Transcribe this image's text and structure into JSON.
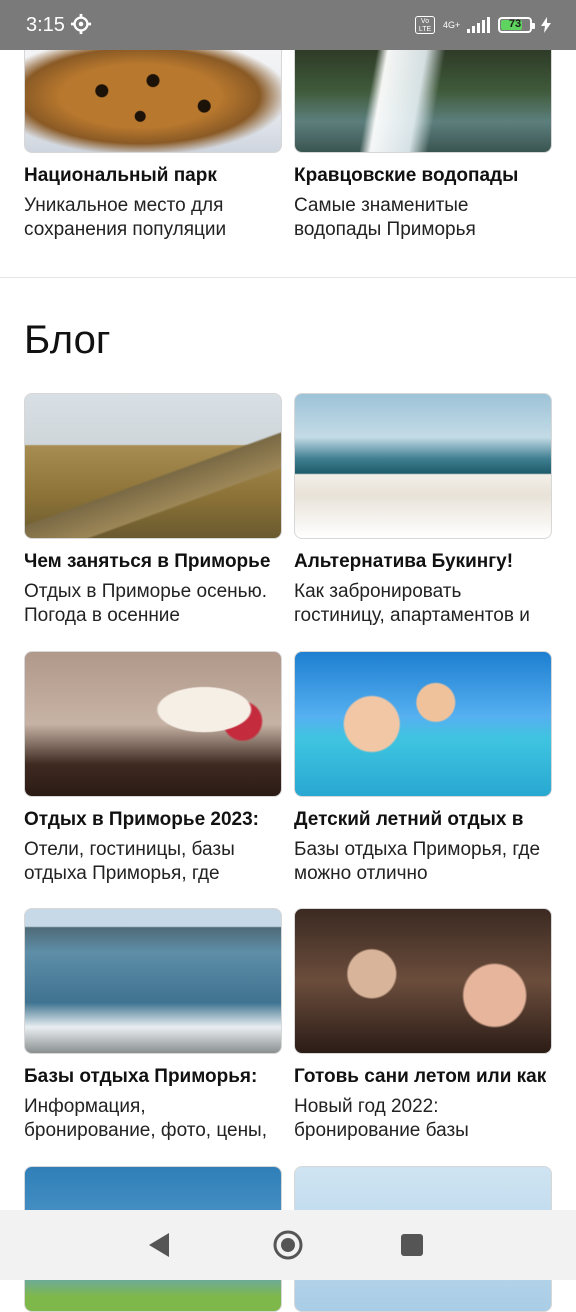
{
  "status_bar": {
    "time": "3:15",
    "network": "4G+",
    "volte": "Vo LTE",
    "battery": "73"
  },
  "top_cards": [
    {
      "title": "Национальный парк",
      "desc": "Уникальное место для сохранения популяции"
    },
    {
      "title": "Кравцовские водопады",
      "desc": "Самые знаменитые водопады Приморья"
    }
  ],
  "blog": {
    "heading": "Блог",
    "cards": [
      {
        "title": "Чем заняться в Приморье",
        "desc": "Отдых в Приморье осенью. Погода в осенние"
      },
      {
        "title": "Альтернатива Букингу!",
        "desc": "Как забронировать гостиницу, апартаментов и"
      },
      {
        "title": "Отдых в Приморье 2023:",
        "desc": "Отели, гостиницы, базы отдыха Приморья, где"
      },
      {
        "title": "Детский летний отдых в",
        "desc": "Базы отдыха Приморья, где можно отлично"
      },
      {
        "title": "Базы отдыха Приморья:",
        "desc": "Информация, бронирование, фото, цены,"
      },
      {
        "title": "Готовь сани летом или как",
        "desc": "Новый год 2022: бронирование базы"
      }
    ]
  },
  "colors": {
    "status_bar_bg": "#7a7a7a",
    "battery_fill": "#5fd35f",
    "nav_bg": "#f2f2f2"
  }
}
